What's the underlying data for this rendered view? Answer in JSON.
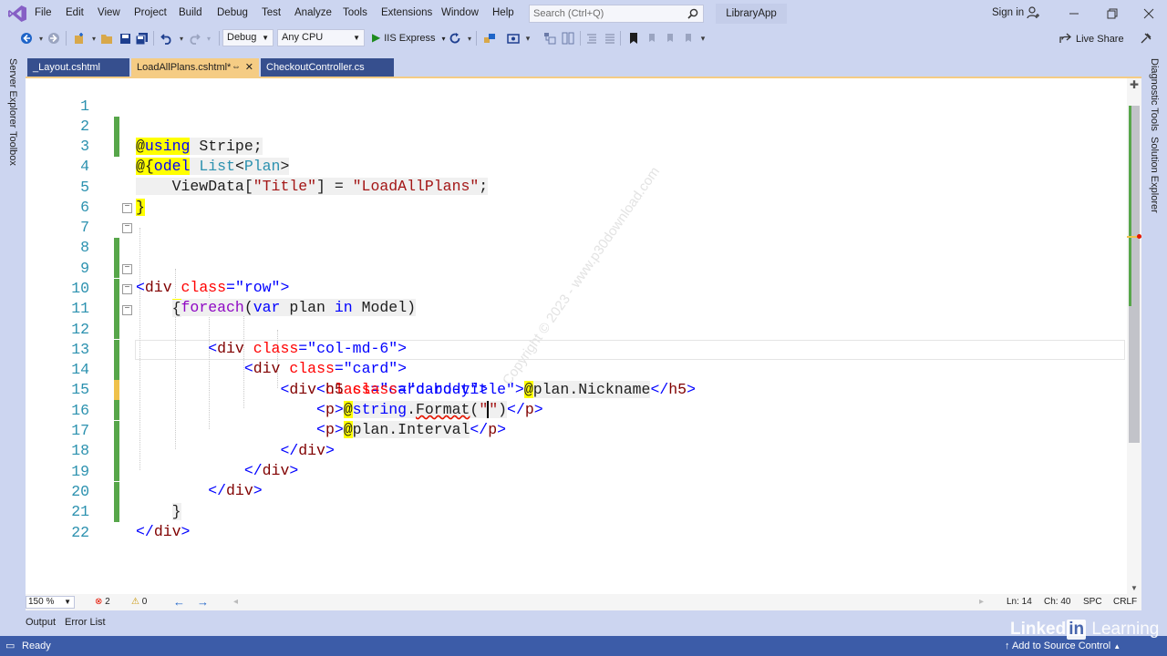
{
  "app": {
    "solution_name": "LibraryApp",
    "sign_in": "Sign in"
  },
  "menu": {
    "items": [
      "File",
      "Edit",
      "View",
      "Project",
      "Build",
      "Debug",
      "Test",
      "Analyze",
      "Tools",
      "Extensions",
      "Window",
      "Help"
    ]
  },
  "search": {
    "placeholder": "Search (Ctrl+Q)"
  },
  "toolbar": {
    "config": "Debug",
    "platform": "Any CPU",
    "run_target": "IIS Express",
    "live_share": "Live Share"
  },
  "side_tabs": {
    "left": [
      "Server Explorer",
      "Toolbox"
    ],
    "right": [
      "Diagnostic Tools",
      "Solution Explorer"
    ]
  },
  "doc_tabs": [
    {
      "label": "_Layout.cshtml",
      "active": false
    },
    {
      "label": "LoadAllPlans.cshtml*",
      "active": true
    },
    {
      "label": "CheckoutController.cs",
      "active": false
    }
  ],
  "code_lines": [
    "@using Stripe;",
    "@model List<Plan>",
    "@{",
    "    ViewData[\"Title\"] = \"LoadAllPlans\";",
    "}",
    "",
    "<div class=\"row\">",
    "    @foreach(var plan in Model)",
    "    {",
    "        <div class=\"col-md-6\">",
    "            <div class=\"card\">",
    "                <div class=\"card-body\">",
    "                    <h5 class=\"card-title\">@plan.Nickname</h5>",
    "                    <p>@string.Format(\"\")</p>",
    "                    <p>@plan.Interval</p>",
    "                </div>",
    "            </div>",
    "        </div>",
    "    }",
    "</div>",
    "",
    ""
  ],
  "editor_status": {
    "zoom": "150 %",
    "errors": "2",
    "warnings": "0",
    "line": "Ln: 14",
    "col": "Ch: 40",
    "mode": "SPC",
    "eol": "CRLF"
  },
  "tool_tabs": [
    "Output",
    "Error List"
  ],
  "status_bar": {
    "ready": "Ready",
    "source_control": "Add to Source Control"
  },
  "branding": {
    "linkedin_a": "Linked",
    "linkedin_b": "in",
    "linkedin_c": " Learning"
  },
  "watermark": "Copyright © 2023 - www.p30download.com",
  "colors": {
    "chrome": "#ccd5f0",
    "active_tab": "#f5cc84",
    "inactive_tab": "#364f8e",
    "status_bar": "#3c5ca8",
    "change_saved": "#57a64a",
    "change_unsaved": "#efc14b"
  }
}
